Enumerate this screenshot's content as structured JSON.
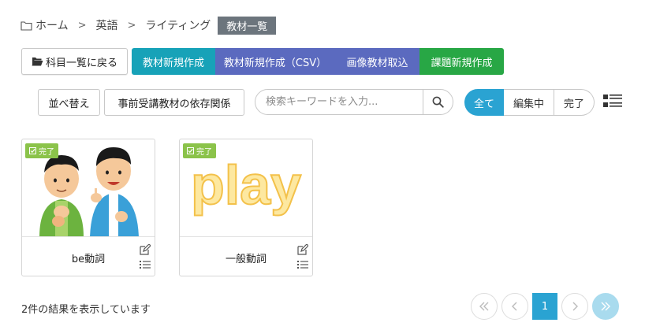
{
  "breadcrumb": {
    "home": "ホーム",
    "sep": ">",
    "level1": "英語",
    "level2": "ライティング",
    "current": "教材一覧"
  },
  "actions": {
    "back": "科目一覧に戻る",
    "create_material": "教材新規作成",
    "create_csv": "教材新規作成（CSV）",
    "import_image": "画像教材取込",
    "create_task": "課題新規作成"
  },
  "toolbar": {
    "sort": "並べ替え",
    "dependency": "事前受講教材の依存関係",
    "search_placeholder": "検索キーワードを入力...",
    "filters": [
      "全て",
      "編集中",
      "完了"
    ],
    "active_filter": "全て"
  },
  "cards": [
    {
      "badge": "完了",
      "title": "be動詞",
      "thumb": "two-men-illustration"
    },
    {
      "badge": "完了",
      "title": "一般動詞",
      "thumb_text": "play"
    }
  ],
  "footer": {
    "result": "2件の結果を表示しています",
    "current_page": "1"
  },
  "colors": {
    "teal": "#17a2b8",
    "indigo": "#5b6abf",
    "green": "#28a745",
    "filter_active": "#2aa3d2",
    "badge": "#8bc34a",
    "breadcrumb_current": "#6c757d"
  }
}
